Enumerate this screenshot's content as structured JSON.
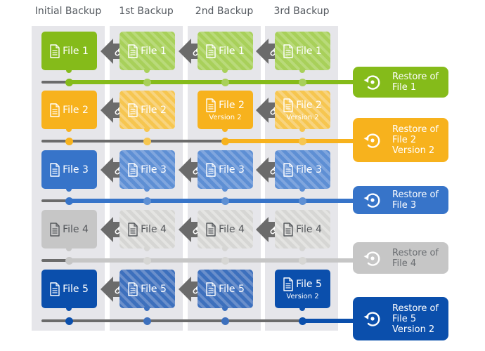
{
  "columns": [
    "Initial Backup",
    "1st Backup",
    "2nd Backup",
    "3rd Backup"
  ],
  "rows": [
    {
      "color": "#85bb1a",
      "light": "#a8d05a",
      "stripe": "#b9da7a",
      "text_color": "#ffffff",
      "tiles": [
        {
          "label": "File 1",
          "sub": "",
          "type": "solid"
        },
        {
          "label": "File 1",
          "sub": "",
          "type": "link"
        },
        {
          "label": "File 1",
          "sub": "",
          "type": "link"
        },
        {
          "label": "File 1",
          "sub": "",
          "type": "link"
        }
      ],
      "restore_from_col": 0,
      "restore_label": "Restore of\nFile 1"
    },
    {
      "color": "#f7b21d",
      "light": "#f6c650",
      "stripe": "#f8d47f",
      "text_color": "#ffffff",
      "tiles": [
        {
          "label": "File 2",
          "sub": "",
          "type": "solid"
        },
        {
          "label": "File 2",
          "sub": "",
          "type": "link"
        },
        {
          "label": "File 2",
          "sub": "Version 2",
          "type": "solid"
        },
        {
          "label": "File 2",
          "sub": "Version 2",
          "type": "link"
        }
      ],
      "restore_from_col": 2,
      "restore_label": "Restore of\nFile 2\nVersion 2"
    },
    {
      "color": "#3774c9",
      "light": "#5e8fd4",
      "stripe": "#80a6de",
      "text_color": "#ffffff",
      "tiles": [
        {
          "label": "File 3",
          "sub": "",
          "type": "solid"
        },
        {
          "label": "File 3",
          "sub": "",
          "type": "link"
        },
        {
          "label": "File 3",
          "sub": "",
          "type": "link"
        },
        {
          "label": "File 3",
          "sub": "",
          "type": "link"
        }
      ],
      "restore_from_col": 0,
      "restore_label": "Restore of\nFile 3"
    },
    {
      "color": "#c6c6c6",
      "light": "#d6d6d4",
      "stripe": "#e4e4e2",
      "text_color": "#55585c",
      "tiles": [
        {
          "label": "File 4",
          "sub": "",
          "type": "solid"
        },
        {
          "label": "File 4",
          "sub": "",
          "type": "link"
        },
        {
          "label": "File 4",
          "sub": "",
          "type": "link"
        },
        {
          "label": "File 4",
          "sub": "",
          "type": "link"
        }
      ],
      "restore_from_col": 0,
      "restore_label": "Restore of\nFile 4"
    },
    {
      "color": "#0b4fac",
      "light": "#3d70bd",
      "stripe": "#6a8fcb",
      "text_color": "#ffffff",
      "tiles": [
        {
          "label": "File 5",
          "sub": "",
          "type": "solid"
        },
        {
          "label": "File 5",
          "sub": "",
          "type": "link"
        },
        {
          "label": "File 5",
          "sub": "",
          "type": "link"
        },
        {
          "label": "File 5",
          "sub": "Version 2",
          "type": "solid"
        }
      ],
      "restore_from_col": 3,
      "restore_label": "Restore of\nFile 5\nVersion 2"
    }
  ],
  "icons": {
    "file": "document-icon",
    "link": "chain-link-icon",
    "restore": "restore-icon"
  },
  "colors": {
    "column_bg": "#e6e6ea",
    "timeline_grey": "#6b6b6b",
    "arrow": "#6b6b6b"
  }
}
